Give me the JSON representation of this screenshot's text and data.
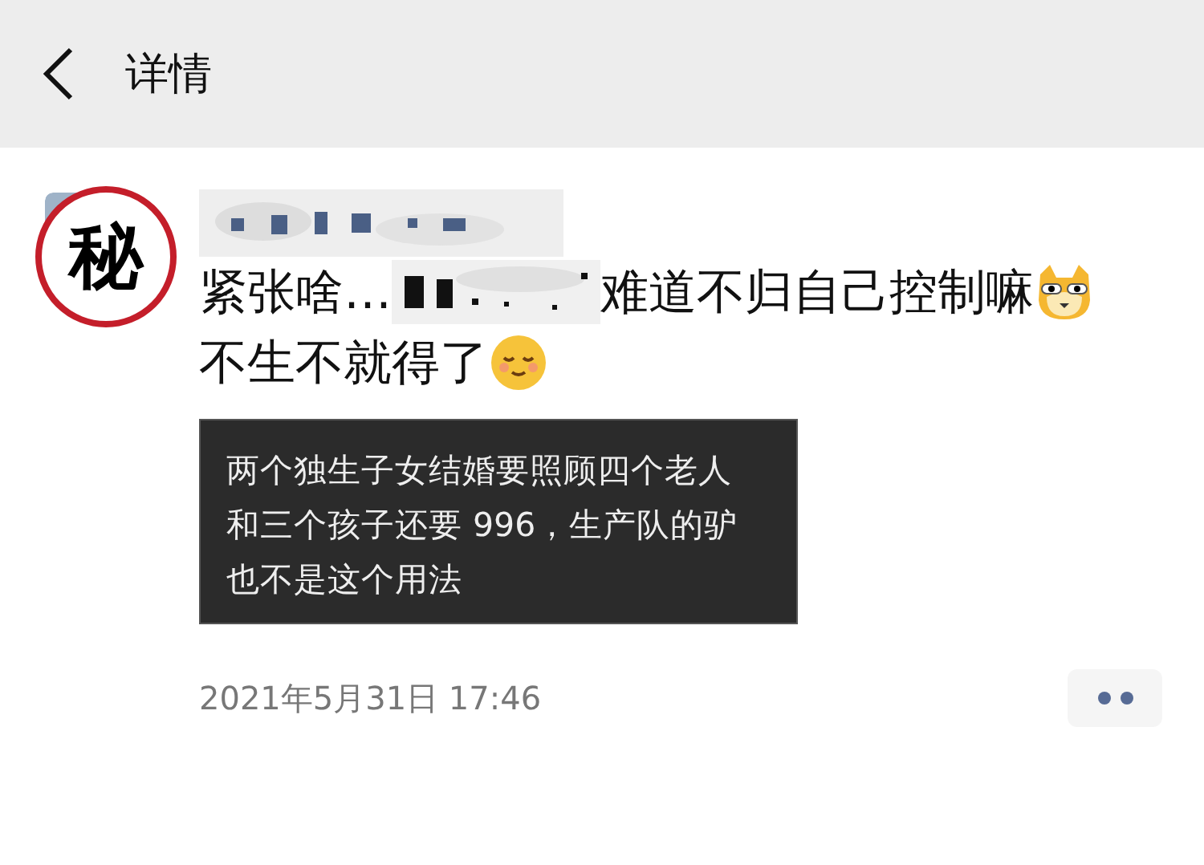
{
  "header": {
    "title": "详情"
  },
  "post": {
    "stamp": "秘",
    "text_before": "紧张啥…",
    "text_after": "难道不归自己控制嘛",
    "line_2": "不生不就得了",
    "screenshot": {
      "lines": [
        "两个独生子女结婚要照顾四个老人",
        "和三个孩子还要 996，生产队的驴",
        "也不是这个用法"
      ]
    },
    "timestamp": "2021年5月31日 17:46"
  }
}
